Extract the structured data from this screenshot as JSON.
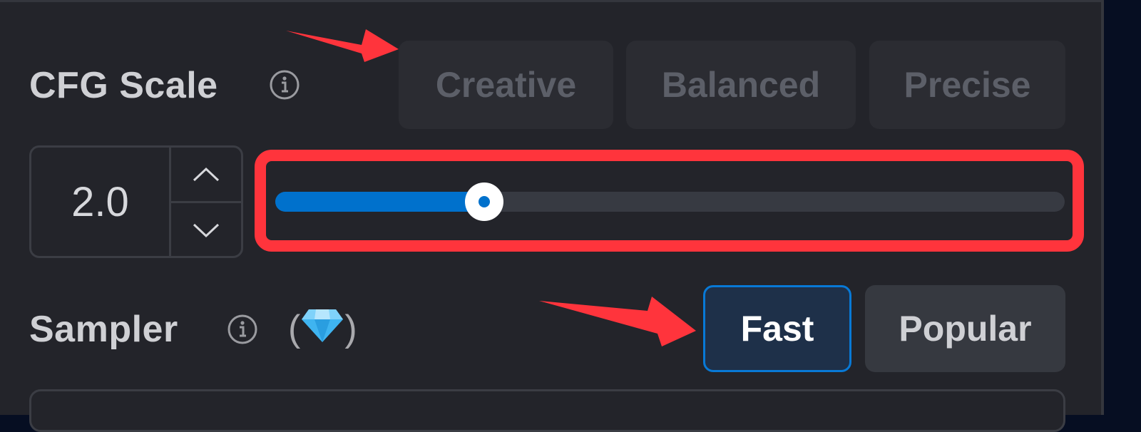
{
  "cfg_scale": {
    "label": "CFG Scale",
    "info_icon": "info-icon",
    "presets": [
      {
        "label": "Creative",
        "state": "disabled"
      },
      {
        "label": "Balanced",
        "state": "disabled"
      },
      {
        "label": "Precise",
        "state": "disabled"
      }
    ],
    "stepper": {
      "value": "2.0",
      "increment_icon": "chevron-up-icon",
      "decrement_icon": "chevron-down-icon"
    },
    "slider": {
      "value": 2.0,
      "fill_fraction": 0.265
    }
  },
  "sampler": {
    "label": "Sampler",
    "info_icon": "info-icon",
    "badge_open": "(",
    "badge_icon": "gem-icon",
    "badge_close": ")",
    "options": [
      {
        "label": "Fast",
        "selected": true
      },
      {
        "label": "Popular",
        "selected": false
      }
    ]
  },
  "annotations": {
    "highlight_color": "#ff343c",
    "arrows": [
      "arrow-to-preset-buttons",
      "arrow-to-fast-button"
    ]
  },
  "colors": {
    "accent": "#0071cc",
    "panel_bg": "#23242a",
    "selected_bg": "#1e3049"
  }
}
